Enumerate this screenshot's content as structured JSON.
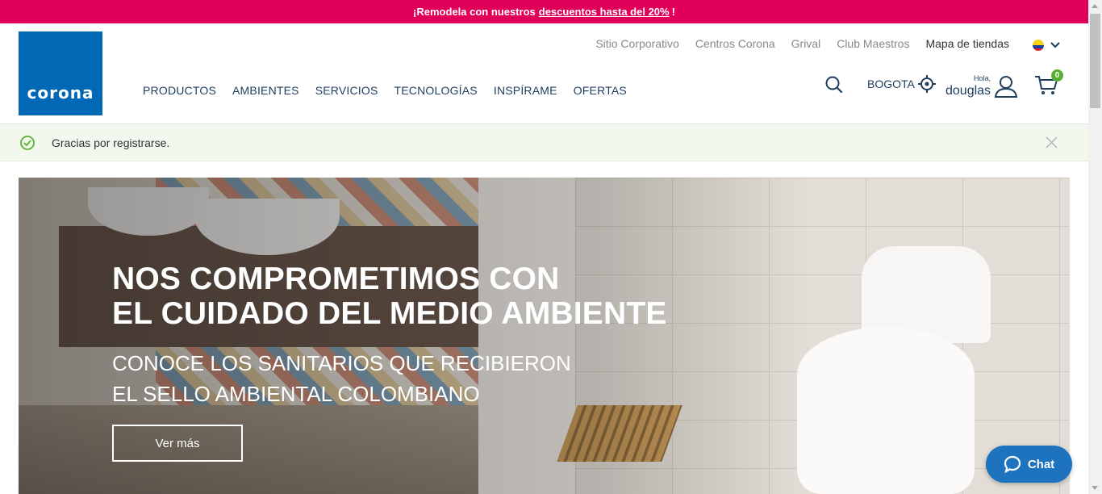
{
  "promo": {
    "text": "¡Remodela con nuestros",
    "link": "descuentos hasta del 20%",
    "end": "!"
  },
  "header": {
    "logo": "corona",
    "toplinks": [
      "Sitio Corporativo",
      "Centros Corona",
      "Grival",
      "Club Maestros",
      "Mapa de tiendas"
    ],
    "nav": [
      "PRODUCTOS",
      "AMBIENTES",
      "SERVICIOS",
      "TECNOLOGÍAS",
      "INSPÍRAME",
      "OFERTAS"
    ],
    "city": "BOGOTA",
    "greeting": "Hola,",
    "username": "douglas",
    "cart_count": "0"
  },
  "notice": {
    "message": "Gracias por registrarse."
  },
  "hero": {
    "title_line1": "NOS COMPROMETIMOS CON",
    "title_line2": "EL CUIDADO DEL MEDIO AMBIENTE",
    "subtitle_line1": "CONOCE LOS SANITARIOS QUE RECIBIERON",
    "subtitle_line2": "EL SELLO AMBIENTAL COLOMBIANO",
    "cta": "Ver más"
  },
  "chat": {
    "label": "Chat"
  },
  "colors": {
    "promo_bg": "#e0005a",
    "brand_blue": "#0068b4",
    "nav_text": "#1d3d5e",
    "success_green": "#58b031",
    "chat_bg": "#1e73be"
  },
  "icons": [
    "check-circle-icon",
    "close-icon",
    "search-icon",
    "location-target-icon",
    "user-icon",
    "cart-icon",
    "chat-bubble-icon",
    "chevron-down-icon",
    "colombia-flag-icon"
  ]
}
